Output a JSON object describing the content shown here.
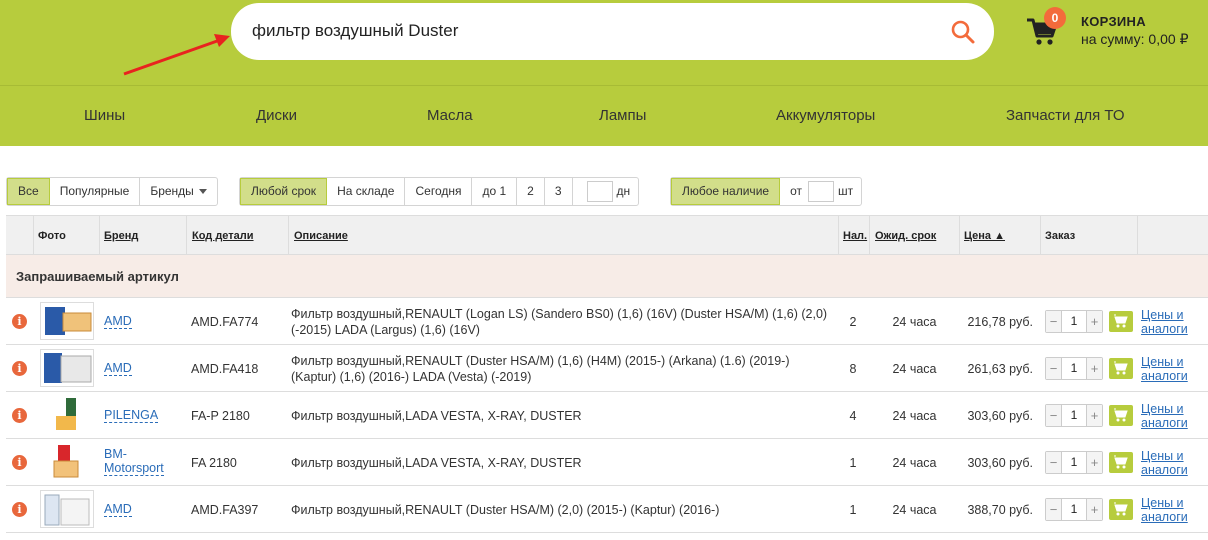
{
  "header": {
    "search_value": "фильтр воздушный Duster",
    "cart_count": "0",
    "cart_title": "КОРЗИНА",
    "cart_sum": "на сумму: 0,00 ₽"
  },
  "nav": [
    "Шины",
    "Диски",
    "Масла",
    "Лампы",
    "Аккумуляторы",
    "Запчасти для ТО"
  ],
  "filters": {
    "scope": [
      "Все",
      "Популярные",
      "Бренды"
    ],
    "term": [
      "Любой срок",
      "На складе",
      "Сегодня",
      "до 1",
      "2",
      "3",
      "дн"
    ],
    "stock": [
      "Любое наличие",
      "от",
      "шт"
    ]
  },
  "table": {
    "headers": {
      "photo": "Фото",
      "brand": "Бренд",
      "code": "Код детали",
      "desc": "Описание",
      "stock": "Нал.",
      "term": "Ожид. срок",
      "price": "Цена ▲",
      "order": "Заказ"
    },
    "group_title": "Запрашиваемый артикул",
    "analog_line1": "Цены и",
    "analog_line2": "аналоги",
    "rows": [
      {
        "brand": "AMD",
        "code": "AMD.FA774",
        "desc": "Фильтр воздушный,RENAULT (Logan LS) (Sandero BS0) (1,6) (16V) (Duster HSA/M) (1,6) (2,0) (-2015) LADA (Largus) (1,6) (16V)",
        "stock": "2",
        "term": "24 часа",
        "price": "216,78 руб.",
        "qty": "1"
      },
      {
        "brand": "AMD",
        "code": "AMD.FA418",
        "desc": "Фильтр воздушный,RENAULT (Duster HSA/M) (1,6) (H4M) (2015-) (Arkana) (1.6) (2019-) (Kaptur) (1,6) (2016-) LADA (Vesta) (-2019)",
        "stock": "8",
        "term": "24 часа",
        "price": "261,63 руб.",
        "qty": "1"
      },
      {
        "brand": "PILENGA",
        "code": "FA-P 2180",
        "desc": "Фильтр воздушный,LADA VESTA, X-RAY, DUSTER",
        "stock": "4",
        "term": "24 часа",
        "price": "303,60 руб.",
        "qty": "1"
      },
      {
        "brand": "BM-Motorsport",
        "brand_l1": "BM-",
        "brand_l2": "Motorsport",
        "code": "FA 2180",
        "desc": "Фильтр воздушный,LADA VESTA, X-RAY, DUSTER",
        "stock": "1",
        "term": "24 часа",
        "price": "303,60 руб.",
        "qty": "1"
      },
      {
        "brand": "AMD",
        "code": "AMD.FA397",
        "desc": "Фильтр воздушный,RENAULT (Duster HSA/M) (2,0) (2015-) (Kaptur) (2016-)",
        "stock": "1",
        "term": "24 часа",
        "price": "388,70 руб.",
        "qty": "1"
      }
    ]
  },
  "colors": {
    "accent": "#b7cc3d",
    "badge": "#f36b3b",
    "link": "#2a6cb8",
    "group_bg": "#f7ece7"
  }
}
